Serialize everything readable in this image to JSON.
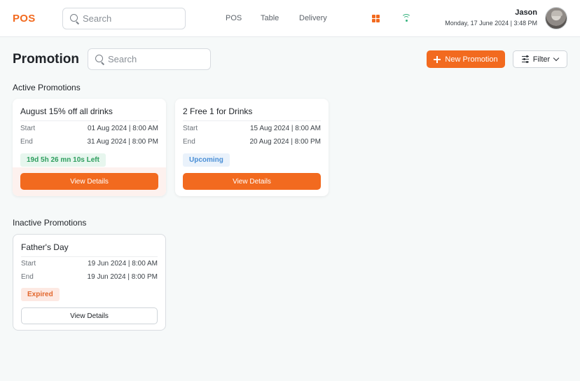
{
  "app": {
    "logo": "POS",
    "search_placeholder": "Search",
    "nav": [
      "POS",
      "Table",
      "Delivery"
    ],
    "user_name": "Jason",
    "datetime": "Monday, 17 June 2024 | 3:48 PM",
    "icons": {
      "apps": "grid-icon",
      "connection": "wifi-icon"
    },
    "colors": {
      "accent": "#f26a1f",
      "wifi": "#36b37e"
    }
  },
  "page": {
    "title": "Promotion",
    "search_placeholder": "Search",
    "new_button": "New Promotion",
    "filter_button": "Filter"
  },
  "active_section": {
    "title": "Active Promotions",
    "cards": [
      {
        "title": "August 15% off all drinks",
        "start_label": "Start",
        "start": "01 Aug 2024 | 8:00 AM",
        "end_label": "End",
        "end": "31 Aug 2024 | 8:00 PM",
        "badge": "19d 5h 26 mn 10s Left",
        "button": "View Details"
      },
      {
        "title": "2 Free 1 for Drinks",
        "start_label": "Start",
        "start": "15 Aug 2024 | 8:00 AM",
        "end_label": "End",
        "end": "20 Aug 2024 | 8:00 PM",
        "badge": "Upcoming",
        "button": "View Details"
      }
    ]
  },
  "inactive_section": {
    "title": "Inactive Promotions",
    "cards": [
      {
        "title": "Father's Day",
        "start_label": "Start",
        "start": "19 Jun 2024 | 8:00 AM",
        "end_label": "End",
        "end": "19 Jun 2024 | 8:00 PM",
        "badge": "Expired",
        "button": "View Details"
      }
    ]
  }
}
